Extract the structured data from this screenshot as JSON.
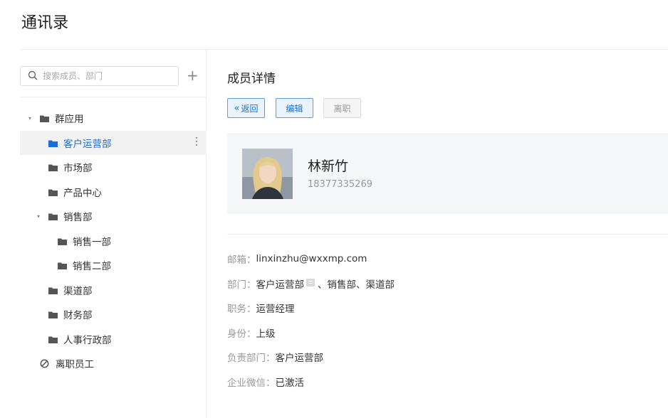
{
  "page": {
    "title": "通讯录"
  },
  "sidebar": {
    "search_placeholder": "搜索成员、部门",
    "add_label": "+",
    "tree": [
      {
        "label": "群应用",
        "caret": "▾"
      },
      {
        "label": "客户运营部"
      },
      {
        "label": "市场部"
      },
      {
        "label": "产品中心"
      },
      {
        "label": "销售部",
        "caret": "▾"
      },
      {
        "label": "销售一部"
      },
      {
        "label": "销售二部"
      },
      {
        "label": "渠道部"
      },
      {
        "label": "财务部"
      },
      {
        "label": "人事行政部"
      },
      {
        "label": "离职员工"
      }
    ]
  },
  "main": {
    "section_title": "成员详情",
    "buttons": {
      "back": "返回",
      "edit": "编辑",
      "leave": "离职"
    },
    "member": {
      "name": "林新竹",
      "phone": "18377335269"
    },
    "details": {
      "email_label": "邮箱：",
      "email_value": "linxinzhu@wxxmp.com",
      "dept_label": "部门：",
      "dept_primary": "客户运营部",
      "dept_others": "、销售部、渠道部",
      "title_label": "职务：",
      "title_value": "运营经理",
      "identity_label": "身份：",
      "identity_value": "上级",
      "leader_label": "负责部门：",
      "leader_value": "客户运营部",
      "wechat_label": "企业微信：",
      "wechat_value": "已激活"
    }
  },
  "colors": {
    "accent": "#1a6fd6",
    "active_bg": "#f2f2f2",
    "card_bg": "#f5f6f7"
  }
}
